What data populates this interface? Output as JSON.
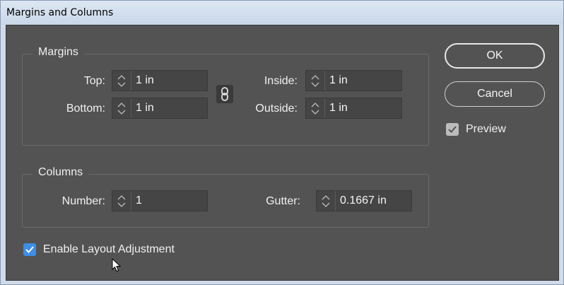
{
  "window": {
    "title": "Margins and Columns"
  },
  "margins": {
    "legend": "Margins",
    "top": {
      "label": "Top:",
      "value": "1 in"
    },
    "bottom": {
      "label": "Bottom:",
      "value": "1 in"
    },
    "inside": {
      "label": "Inside:",
      "value": "1 in"
    },
    "outside": {
      "label": "Outside:",
      "value": "1 in"
    }
  },
  "columns": {
    "legend": "Columns",
    "number": {
      "label": "Number:",
      "value": "1"
    },
    "gutter": {
      "label": "Gutter:",
      "value": "0.1667 in"
    }
  },
  "buttons": {
    "ok": "OK",
    "cancel": "Cancel"
  },
  "preview": {
    "label": "Preview",
    "checked": true
  },
  "layout_adjustment": {
    "label": "Enable Layout Adjustment",
    "checked": true
  },
  "colors": {
    "dialog_bg": "#535353",
    "field_bg": "#454545",
    "checkbox_accent": "#3d8ee6"
  }
}
